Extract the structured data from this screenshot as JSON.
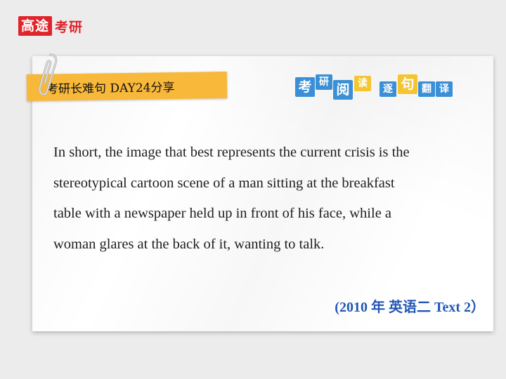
{
  "logo": {
    "box_text": "高途",
    "text": "考研",
    "color": "#e0242b"
  },
  "title_bar": {
    "text": "考研长难句 DAY24分享",
    "color": "#f8b83a"
  },
  "decorative_title": {
    "chars": [
      "考",
      "研",
      "阅",
      "读",
      "逐",
      "句",
      "翻",
      "译"
    ],
    "colors": {
      "blue": "#3a8fd6",
      "yellow": "#f4c531"
    }
  },
  "body": {
    "lines": [
      "In short, the image that best represents the current crisis is the",
      "stereotypical cartoon scene of a man sitting at the breakfast",
      "table with a newspaper held up in front of his face, while a",
      "woman glares at the back of it, wanting to talk."
    ]
  },
  "source": {
    "text": "(2010 年 英语二 Text 2）",
    "color": "#2357b4"
  }
}
